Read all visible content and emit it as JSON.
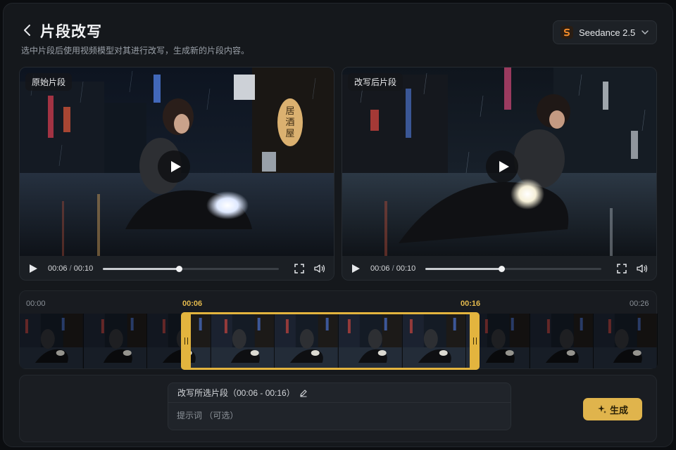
{
  "header": {
    "title": "片段改写",
    "subtitle": "选中片段后使用视频模型对其进行改写，生成新的片段内容。"
  },
  "model_selector": {
    "value": "Seedance 2.5",
    "icon": "seedance-logo-icon"
  },
  "panels": [
    {
      "tag": "原始片段",
      "sign_text": "居酒屋",
      "current_time": "00:06",
      "separator": "/",
      "duration": "00:10",
      "progress": 0.43
    },
    {
      "tag": "改写后片段",
      "current_time": "00:06",
      "separator": "/",
      "duration": "00:10",
      "progress": 0.43
    }
  ],
  "timeline": {
    "start_label": "00:00",
    "selection_start_label": "00:06",
    "selection_end_label": "00:16",
    "end_label": "00:26",
    "selection_start_seconds": 6,
    "selection_end_seconds": 16,
    "total_seconds": 26,
    "frame_count": 10
  },
  "prompt": {
    "header": "改写所选片段（00:06 - 00:16）",
    "placeholder": "提示词 （可选）",
    "value": ""
  },
  "actions": {
    "generate_label": "生成"
  },
  "colors": {
    "accent": "#e0b44c",
    "background": "#15181c",
    "panel": "#1b1f24"
  }
}
